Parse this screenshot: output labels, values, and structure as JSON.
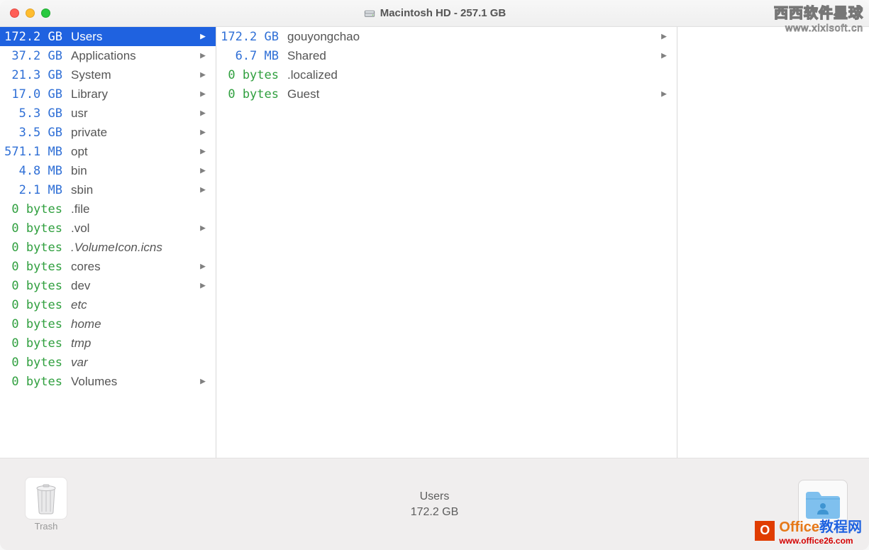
{
  "window": {
    "title": "Macintosh HD - 257.1 GB",
    "disk_icon": "disk-icon"
  },
  "columns": [
    {
      "items": [
        {
          "size": "172.2 GB",
          "zero": false,
          "name": "Users",
          "italic": false,
          "arrow": true,
          "selected": true
        },
        {
          "size": "37.2 GB",
          "zero": false,
          "name": "Applications",
          "italic": false,
          "arrow": true,
          "selected": false
        },
        {
          "size": "21.3 GB",
          "zero": false,
          "name": "System",
          "italic": false,
          "arrow": true,
          "selected": false
        },
        {
          "size": "17.0 GB",
          "zero": false,
          "name": "Library",
          "italic": false,
          "arrow": true,
          "selected": false
        },
        {
          "size": "5.3 GB",
          "zero": false,
          "name": "usr",
          "italic": false,
          "arrow": true,
          "selected": false
        },
        {
          "size": "3.5 GB",
          "zero": false,
          "name": "private",
          "italic": false,
          "arrow": true,
          "selected": false
        },
        {
          "size": "571.1 MB",
          "zero": false,
          "name": "opt",
          "italic": false,
          "arrow": true,
          "selected": false
        },
        {
          "size": "4.8 MB",
          "zero": false,
          "name": "bin",
          "italic": false,
          "arrow": true,
          "selected": false
        },
        {
          "size": "2.1 MB",
          "zero": false,
          "name": "sbin",
          "italic": false,
          "arrow": true,
          "selected": false
        },
        {
          "size": "0 bytes",
          "zero": true,
          "name": ".file",
          "italic": false,
          "arrow": false,
          "selected": false
        },
        {
          "size": "0 bytes",
          "zero": true,
          "name": ".vol",
          "italic": false,
          "arrow": true,
          "selected": false
        },
        {
          "size": "0 bytes",
          "zero": true,
          "name": ".VolumeIcon.icns",
          "italic": true,
          "arrow": false,
          "selected": false
        },
        {
          "size": "0 bytes",
          "zero": true,
          "name": "cores",
          "italic": false,
          "arrow": true,
          "selected": false
        },
        {
          "size": "0 bytes",
          "zero": true,
          "name": "dev",
          "italic": false,
          "arrow": true,
          "selected": false
        },
        {
          "size": "0 bytes",
          "zero": true,
          "name": "etc",
          "italic": true,
          "arrow": false,
          "selected": false
        },
        {
          "size": "0 bytes",
          "zero": true,
          "name": "home",
          "italic": true,
          "arrow": false,
          "selected": false
        },
        {
          "size": "0 bytes",
          "zero": true,
          "name": "tmp",
          "italic": true,
          "arrow": false,
          "selected": false
        },
        {
          "size": "0 bytes",
          "zero": true,
          "name": "var",
          "italic": true,
          "arrow": false,
          "selected": false
        },
        {
          "size": "0 bytes",
          "zero": true,
          "name": "Volumes",
          "italic": false,
          "arrow": true,
          "selected": false
        }
      ]
    },
    {
      "items": [
        {
          "size": "172.2 GB",
          "zero": false,
          "name": "gouyongchao",
          "italic": false,
          "arrow": true,
          "selected": false
        },
        {
          "size": "6.7 MB",
          "zero": false,
          "name": "Shared",
          "italic": false,
          "arrow": true,
          "selected": false
        },
        {
          "size": "0 bytes",
          "zero": true,
          "name": ".localized",
          "italic": false,
          "arrow": false,
          "selected": false
        },
        {
          "size": "0 bytes",
          "zero": true,
          "name": "Guest",
          "italic": false,
          "arrow": true,
          "selected": false
        }
      ]
    }
  ],
  "footer": {
    "trash_label": "Trash",
    "selected_name": "Users",
    "selected_size": "172.2 GB"
  },
  "watermark1": {
    "line1": "西西软件星球",
    "line2": "www.xixisoft.cn"
  },
  "watermark2": {
    "badge": "O",
    "brand_orange": "Office",
    "brand_rest": "教程网",
    "url": "www.office26.com"
  }
}
